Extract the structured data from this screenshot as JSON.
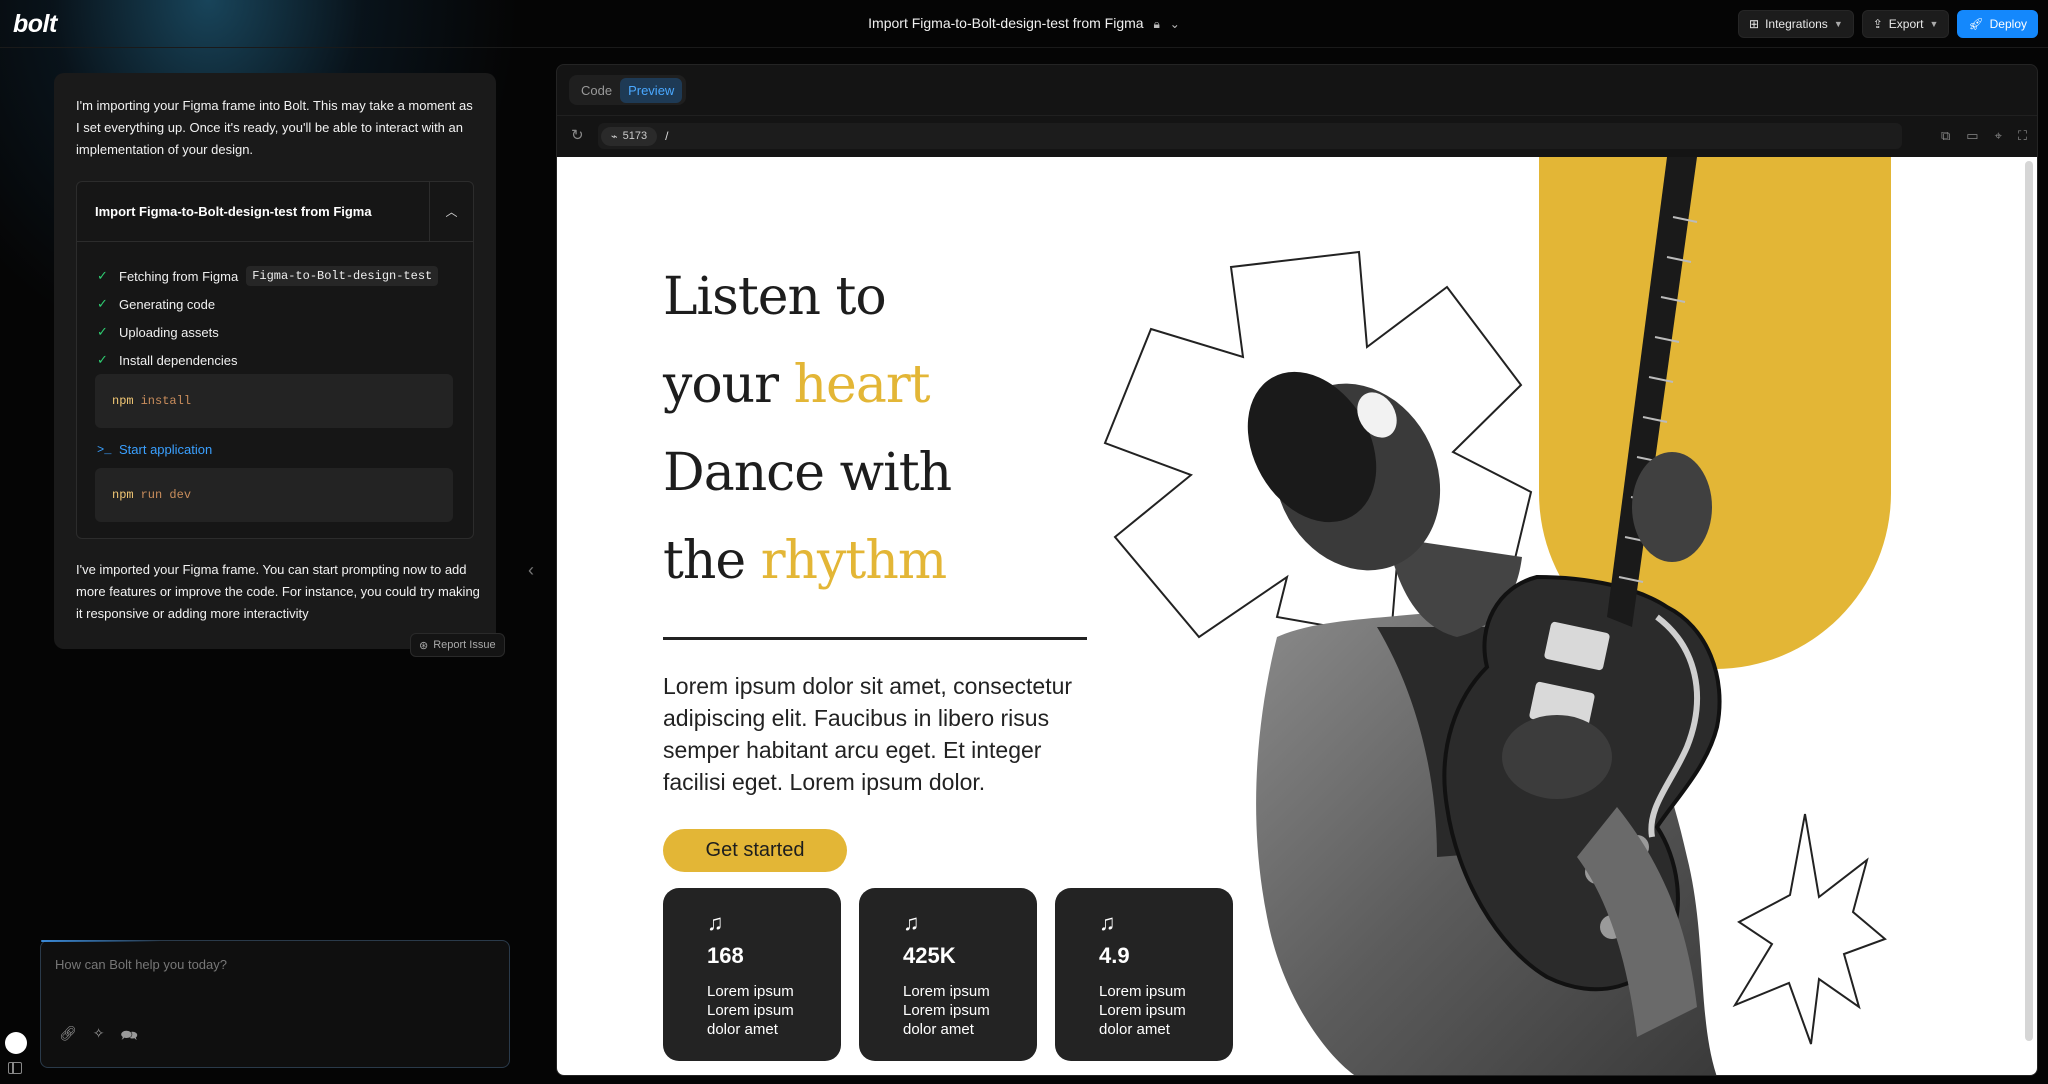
{
  "header": {
    "logo": "bolt",
    "project_title": "Import Figma-to-Bolt-design-test from Figma",
    "actions": {
      "integrations": "Integrations",
      "export": "Export",
      "deploy": "Deploy"
    }
  },
  "chat": {
    "intro": "I'm importing your Figma frame into Bolt. This may take a moment as I set everything up. Once it's ready, you'll be able to interact with an implementation of your design.",
    "import_box": {
      "title": "Import Figma-to-Bolt-design-test from Figma",
      "steps": [
        {
          "label": "Fetching from Figma",
          "chip": "Figma-to-Bolt-design-test"
        },
        {
          "label": "Generating code"
        },
        {
          "label": "Uploading assets"
        },
        {
          "label": "Install dependencies"
        }
      ],
      "cmd1": {
        "keyword": "npm",
        "args": "install"
      },
      "start_app": "Start application",
      "cmd2": {
        "keyword": "npm",
        "args": "run dev"
      }
    },
    "outro": "I've imported your Figma frame. You can start prompting now to add more features or improve the code. For instance, you could try making it responsive or adding more interactivity",
    "report_issue": "Report Issue",
    "prompt": {
      "placeholder": "How can Bolt help you today?"
    }
  },
  "preview": {
    "tabs": [
      "Code",
      "Preview"
    ],
    "active_tab": "Preview",
    "port": "5173",
    "path": "/",
    "site": {
      "headline": {
        "line1": "Listen to",
        "line2_a": "your ",
        "line2_b": "heart",
        "line3": "Dance with",
        "line4_a": "the ",
        "line4_b": "rhythm"
      },
      "body": "Lorem ipsum dolor sit amet, consectetur adipiscing elit. Faucibus in libero risus semper habitant arcu eget. Et integer facilisi eget. Lorem ipsum dolor.",
      "cta": "Get started",
      "stats": [
        {
          "value": "168",
          "desc": "Lorem ipsum Lorem ipsum dolor amet"
        },
        {
          "value": "425K",
          "desc": "Lorem ipsum Lorem ipsum dolor amet"
        },
        {
          "value": "4.9",
          "desc": "Lorem ipsum Lorem ipsum dolor amet"
        }
      ],
      "colors": {
        "accent": "#e3b636",
        "dark": "#232323"
      }
    }
  }
}
